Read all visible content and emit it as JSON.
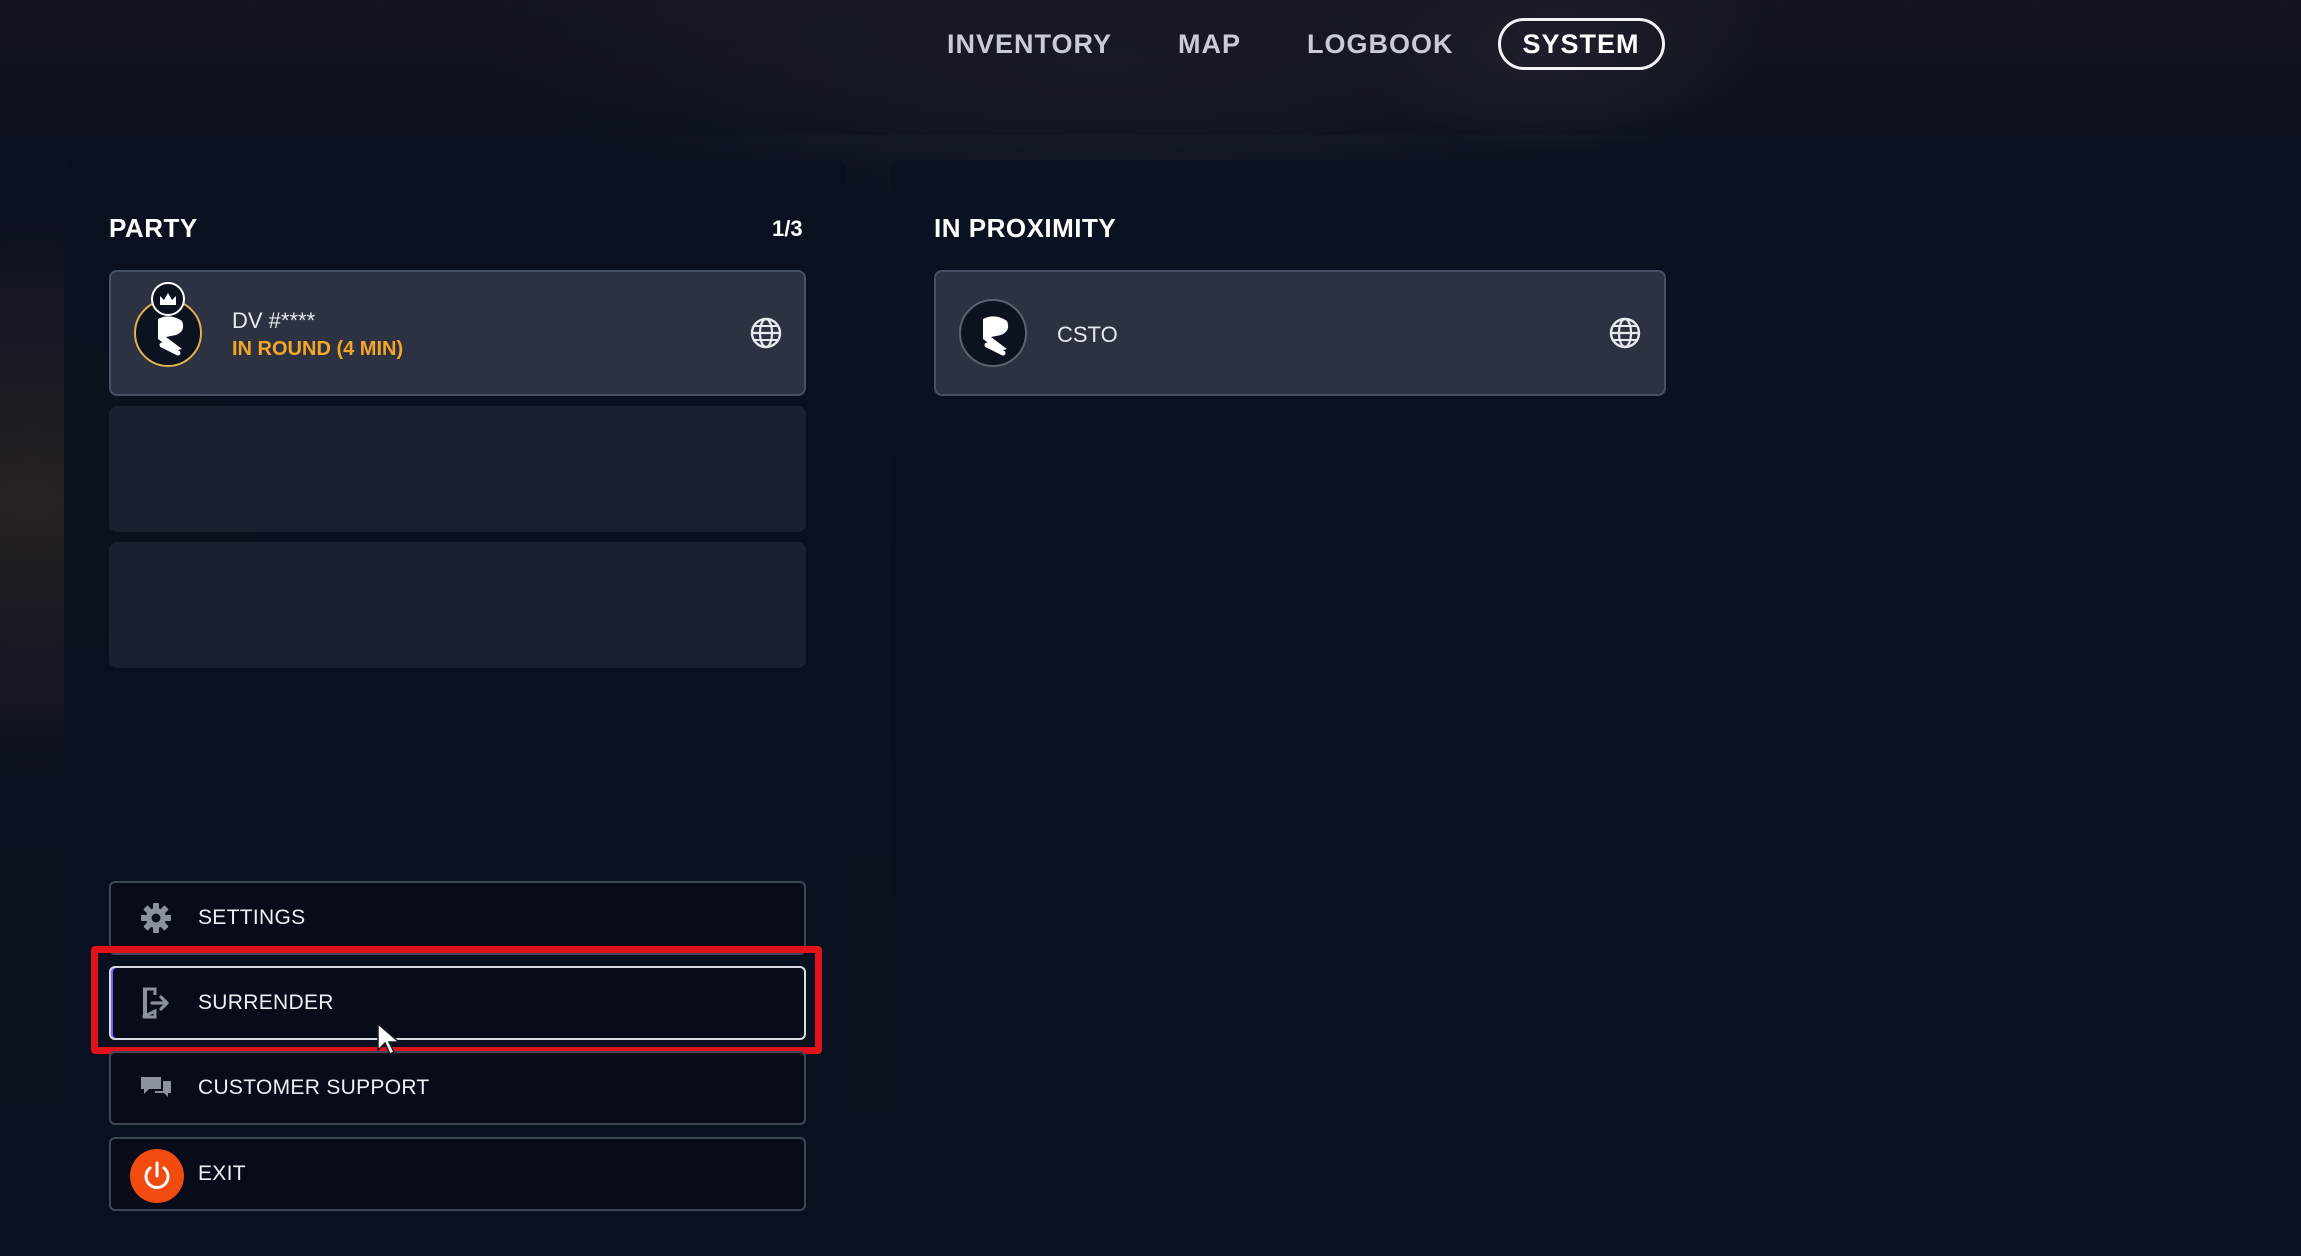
{
  "nav": {
    "tabs": [
      {
        "label": "INVENTORY",
        "active": false
      },
      {
        "label": "MAP",
        "active": false
      },
      {
        "label": "LOGBOOK",
        "active": false
      },
      {
        "label": "SYSTEM",
        "active": true
      }
    ]
  },
  "party": {
    "title": "PARTY",
    "count": "1/3",
    "members": [
      {
        "name": "DV #****",
        "status": "IN ROUND (4 MIN)",
        "icon": "globe-icon"
      }
    ]
  },
  "proximity": {
    "title": "IN PROXIMITY",
    "players": [
      {
        "name": "CSTO",
        "icon": "globe-icon"
      }
    ]
  },
  "menu": {
    "settings_label": "SETTINGS",
    "surrender_label": "SURRENDER",
    "support_label": "CUSTOMER SUPPORT",
    "exit_label": "EXIT"
  },
  "colors": {
    "accent_status": "#f5a623",
    "exit_accent": "#f24b10",
    "highlight": "#e0121b",
    "background": "#0b1120"
  }
}
